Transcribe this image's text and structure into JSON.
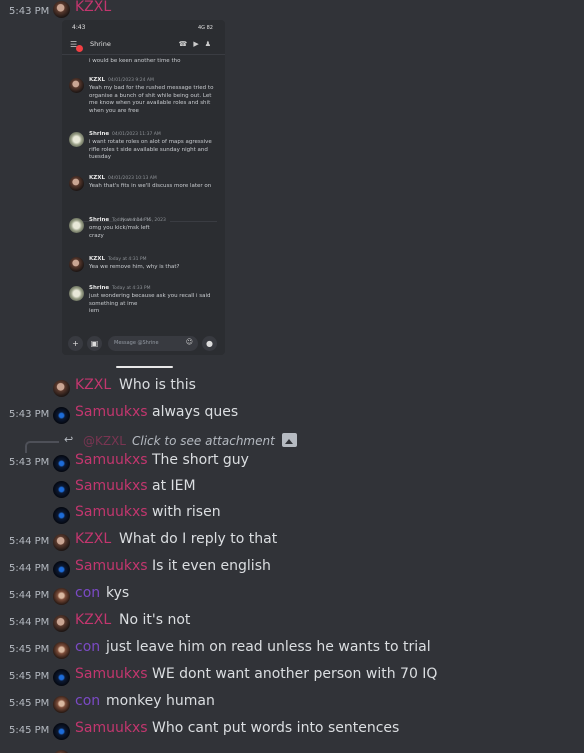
{
  "top": {
    "time": "5:43 PM",
    "name": "KZXL"
  },
  "attachment": {
    "status_time": "4:43",
    "status_icons": "4G 82",
    "channel": "Shrine",
    "first_line": "i would be keen another time tho",
    "messages": [
      {
        "author": "KZXL",
        "date": "04/01/2023 9:24 AM",
        "text": "Yeah my bad for the rushed message tried to organise a bunch of shit while being out. Let me know when your available roles and shit when you are free"
      },
      {
        "author": "Shrine",
        "date": "04/01/2023 11:37 AM",
        "text": "i want rotate roles on alot of maps agressive rifle roles t side  available sunday night and tuesday"
      },
      {
        "author": "KZXL",
        "date": "04/01/2023 10:13 AM",
        "text": "Yeah that's fits in we'll discuss more later on"
      },
      {
        "author": "Shrine",
        "date": "Today at 4:14 PM",
        "text": "omg you kick/msk left\ncrazy"
      },
      {
        "author": "KZXL",
        "date": "Today at 4:31 PM",
        "text": "Yea we remove him, why is that?"
      },
      {
        "author": "Shrine",
        "date": "Today at 4:33 PM",
        "text": "just wondering because ask you recall i said something at ime\niem"
      }
    ],
    "divider": "November 15, 2023",
    "input_placeholder": "Message @Shrine"
  },
  "reply": {
    "name": "@KZXL",
    "text": "Click to see attachment"
  },
  "messages": [
    {
      "time": "",
      "author": "KZXL",
      "text": "Who is this"
    },
    {
      "time": "5:43 PM",
      "author": "Samuukxs",
      "text": "always ques"
    },
    {
      "time": "5:43 PM",
      "author": "Samuukxs",
      "text": "The short guy"
    },
    {
      "time": "",
      "author": "Samuukxs",
      "text": "at IEM"
    },
    {
      "time": "",
      "author": "Samuukxs",
      "text": "with risen"
    },
    {
      "time": "5:44 PM",
      "author": "KZXL",
      "text": "What do I reply to that"
    },
    {
      "time": "5:44 PM",
      "author": "Samuukxs",
      "text": "Is it even english"
    },
    {
      "time": "5:44 PM",
      "author": "con",
      "text": "kys"
    },
    {
      "time": "5:44 PM",
      "author": "KZXL",
      "text": "No it's not"
    },
    {
      "time": "5:45 PM",
      "author": "con",
      "text": "just leave him on read unless he wants to trial"
    },
    {
      "time": "5:45 PM",
      "author": "Samuukxs",
      "text": "WE dont want another person with 70 IQ"
    },
    {
      "time": "5:45 PM",
      "author": "con",
      "text": "monkey human"
    },
    {
      "time": "5:45 PM",
      "author": "Samuukxs",
      "text": "Who cant put words into sentences"
    }
  ],
  "colors": {
    "background": "#313338",
    "kzxl": "#c2366e",
    "samuukxs": "#c2366e",
    "con": "#7b4ac5"
  }
}
